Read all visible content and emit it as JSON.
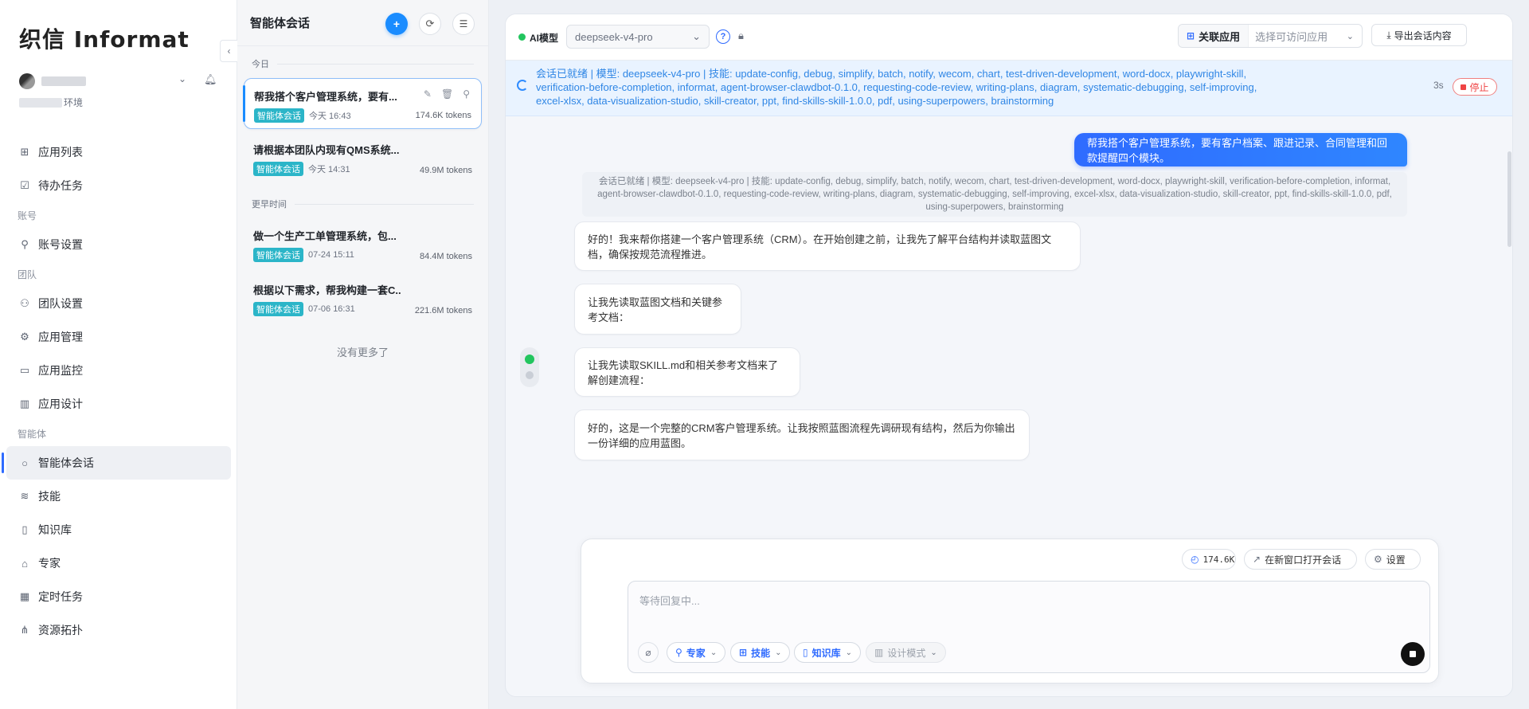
{
  "brand": {
    "logo_text": "织信 Informat"
  },
  "user": {
    "env_suffix": "环境"
  },
  "nav": {
    "top_items": [
      {
        "label": "应用列表",
        "icon": "grid-icon"
      },
      {
        "label": "待办任务",
        "icon": "checkbox-icon"
      }
    ],
    "group_account": "账号",
    "account_items": [
      {
        "label": "账号设置",
        "icon": "user-icon"
      }
    ],
    "group_team": "团队",
    "team_items": [
      {
        "label": "团队设置",
        "icon": "team-icon"
      },
      {
        "label": "应用管理",
        "icon": "gear-icon"
      },
      {
        "label": "应用监控",
        "icon": "monitor-icon"
      },
      {
        "label": "应用设计",
        "icon": "design-icon"
      }
    ],
    "group_agent": "智能体",
    "agent_items": [
      {
        "label": "智能体会话",
        "icon": "chat-icon",
        "active": true
      },
      {
        "label": "技能",
        "icon": "layers-icon"
      },
      {
        "label": "知识库",
        "icon": "book-icon"
      },
      {
        "label": "专家",
        "icon": "robot-icon"
      },
      {
        "label": "定时任务",
        "icon": "calendar-icon"
      },
      {
        "label": "资源拓扑",
        "icon": "topology-icon"
      }
    ]
  },
  "conversations": {
    "title": "智能体会话",
    "group_today": "今日",
    "group_earlier": "更早时间",
    "tag_label": "智能体会话",
    "items": [
      {
        "title": "帮我搭个客户管理系统，要有...",
        "time": "今天 16:43",
        "tokens": "174.6K tokens",
        "active": true
      },
      {
        "title": "请根据本团队内现有QMS系统...",
        "time": "今天 14:31",
        "tokens": "49.9M tokens"
      },
      {
        "title": "做一个生产工单管理系统，包...",
        "time": "07-24 15:11",
        "tokens": "84.4M tokens"
      },
      {
        "title": "根据以下需求，帮我构建一套C...",
        "time": "07-06 16:31",
        "tokens": "221.6M tokens"
      }
    ],
    "no_more": "没有更多了"
  },
  "topbar": {
    "ai_label": "AI模型",
    "model_value": "deepseek-v4-pro",
    "link_app_label": "关联应用",
    "link_app_placeholder": "选择可访问应用",
    "export_label": "导出会话内容"
  },
  "status": {
    "text": "会话已就绪 | 模型: deepseek-v4-pro | 技能: update-config, debug, simplify, batch, notify, wecom, chart, test-driven-development, word-docx, playwright-skill, verification-before-completion, informat, agent-browser-clawdbot-0.1.0, requesting-code-review, writing-plans, diagram, systematic-debugging, self-improving, excel-xlsx, data-visualization-studio, skill-creator, ppt, find-skills-skill-1.0.0, pdf, using-superpowers, brainstorming",
    "seconds": "3s",
    "stop_label": "停止"
  },
  "chat": {
    "user_message": "帮我搭个客户管理系统，要有客户档案、跟进记录、合同管理和回款提醒四个模块。",
    "system_note": "会话已就绪 | 模型: deepseek-v4-pro | 技能: update-config, debug, simplify, batch, notify, wecom, chart, test-driven-development, word-docx, playwright-skill, verification-before-completion, informat, agent-browser-clawdbot-0.1.0, requesting-code-review, writing-plans, diagram, systematic-debugging, self-improving, excel-xlsx, data-visualization-studio, skill-creator, ppt, find-skills-skill-1.0.0, pdf, using-superpowers, brainstorming",
    "assistant_messages": [
      "好的！我来帮你搭建一个客户管理系统（CRM）。在开始创建之前，让我先了解平台结构并读取蓝图文档，确保按规范流程推进。",
      "让我先读取蓝图文档和关键参考文档：",
      "让我先读取SKILL.md和相关参考文档来了解创建流程：",
      "好的，这是一个完整的CRM客户管理系统。让我按照蓝图流程先调研现有结构，然后为你输出一份详细的应用蓝图。"
    ]
  },
  "composer": {
    "token_count": "174.6K",
    "open_window_label": "在新窗口打开会话",
    "settings_label": "设置",
    "placeholder": "等待回复中...",
    "tools": {
      "expert": "专家",
      "skills": "技能",
      "knowledge": "知识库",
      "design_mode": "设计模式"
    }
  }
}
